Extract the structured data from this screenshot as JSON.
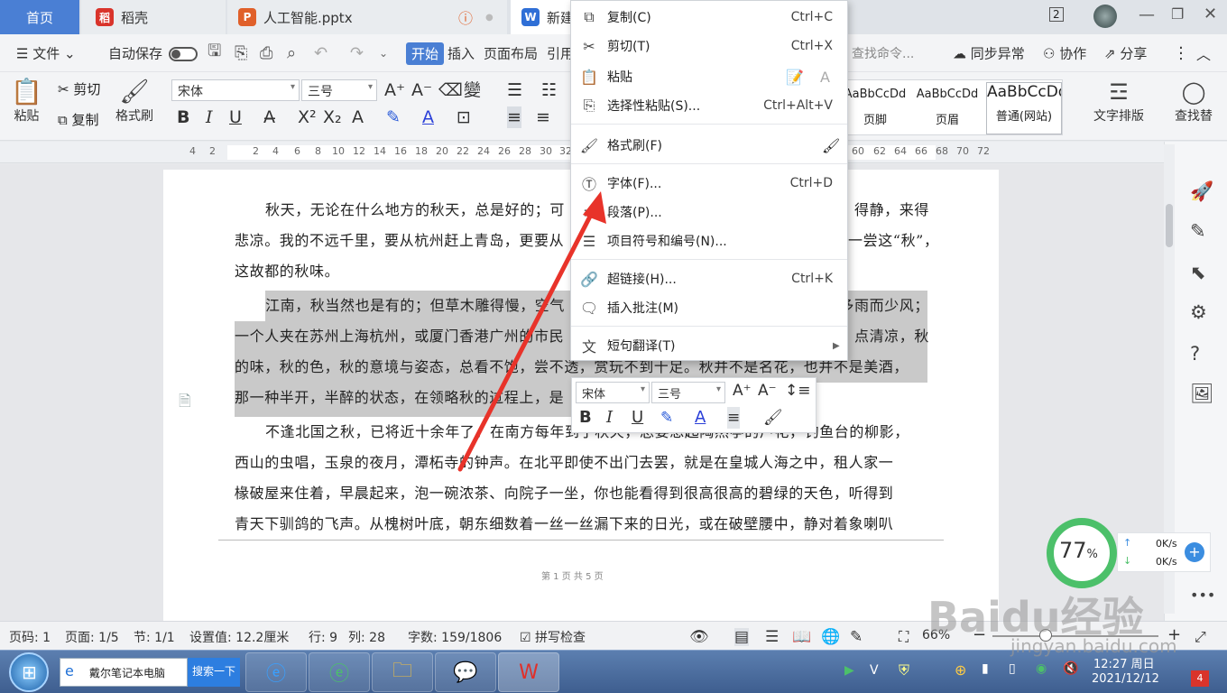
{
  "tabs": {
    "home": "首页",
    "docer": "稻壳",
    "ppt": "人工智能.pptx",
    "doc": "新建"
  },
  "window": {
    "badge": "2"
  },
  "menubar": {
    "file": "文件",
    "autosave": "自动保存",
    "start": "开始",
    "insert": "插入",
    "layout": "页面布局",
    "reference": "引用",
    "search": "查找命令...",
    "sync": "同步异常",
    "collab": "协作",
    "share": "分享"
  },
  "ribbon": {
    "cut": "剪切",
    "copy": "复制",
    "paste": "粘贴",
    "format_painter": "格式刷",
    "font": "宋体",
    "size": "三号",
    "bold": "B",
    "italic": "I",
    "underline": "U",
    "styles": [
      {
        "preview": "AaBbCcDd",
        "name": "页脚"
      },
      {
        "preview": "AaBbCcDd",
        "name": "页眉"
      },
      {
        "preview": "AaBbCcDd",
        "name": "普通(网站)"
      }
    ],
    "text_layout": "文字排版",
    "find_replace": "查找替"
  },
  "ruler": [
    "4",
    "2",
    "2",
    "4",
    "6",
    "8",
    "10",
    "12",
    "14",
    "16",
    "18",
    "20",
    "22",
    "24",
    "26",
    "28",
    "30",
    "32",
    "60",
    "62",
    "64",
    "66",
    "68",
    "70",
    "72"
  ],
  "document": {
    "paragraphs": [
      {
        "lines": [
          "秋天，无论在什么地方的秋天，总是好的；可",
          "得静，来得",
          "悲凉。我的不远千里，要从杭州赶上青岛，更要从",
          "一尝这“秋”，",
          "这故都的秋味。"
        ]
      },
      {
        "lines": [
          "江南，秋当然也是有的；但草木雕得慢，空气",
          "多雨而少风；",
          "一个人夹在苏州上海杭州，或厦门香港广州的市民",
          "点清凉，秋",
          "的味，秋的色，秋的意境与姿态，总看不饱，尝不透，赏玩不到十足。秋并不是名花，也并不是美酒，",
          "那一种半开，半醉的状态，在领略秋的过程上，是"
        ]
      },
      {
        "lines": [
          "不逢北国之秋，已将近十余年了。在南方每年到了秋天，总要想起陶然亭的芦花，钓鱼台的柳影，",
          "西山的虫唱，玉泉的夜月，潭柘寺的钟声。在北平即使不出门去罢，就是在皇城人海之中，租人家一",
          "椽破屋来住着，早晨起来，泡一碗浓茶、向院子一坐，你也能看得到很高很高的碧绿的天色，听得到",
          "青天下驯鸽的飞声。从槐树叶底，朝东细数着一丝一丝漏下来的日光，或在破壁腰中，静对着象喇叭"
        ]
      }
    ],
    "footer": "第 1 页 共 5 页"
  },
  "context_menu": [
    {
      "label": "复制(C)",
      "shortcut": "Ctrl+C",
      "icon": "copy-icon"
    },
    {
      "label": "剪切(T)",
      "shortcut": "Ctrl+X",
      "icon": "scissors-icon"
    },
    {
      "label": "粘贴",
      "shortcut": "",
      "icon": "paste-icon"
    },
    {
      "label": "选择性粘贴(S)...",
      "shortcut": "Ctrl+Alt+V",
      "icon": "paste-special-icon"
    },
    {
      "label": "格式刷(F)",
      "shortcut": "",
      "icon": "format-painter-icon"
    },
    {
      "label": "字体(F)...",
      "shortcut": "Ctrl+D",
      "icon": "font-icon"
    },
    {
      "label": "段落(P)...",
      "shortcut": "",
      "icon": "paragraph-icon"
    },
    {
      "label": "项目符号和编号(N)...",
      "shortcut": "",
      "icon": "bullets-icon"
    },
    {
      "label": "超链接(H)...",
      "shortcut": "Ctrl+K",
      "icon": "link-icon"
    },
    {
      "label": "插入批注(M)",
      "shortcut": "",
      "icon": "comment-icon"
    },
    {
      "label": "短句翻译(T)",
      "shortcut": "",
      "icon": "translate-icon"
    }
  ],
  "mini_toolbar": {
    "font": "宋体",
    "size": "三号"
  },
  "status": {
    "page": "页码: 1",
    "pages": "页面: 1/5",
    "section": "节: 1/1",
    "setting": "设置值: 12.2厘米",
    "row": "行: 9",
    "col": "列: 28",
    "words": "字数: 159/1806",
    "spell": "拼写检查",
    "zoom": "66%"
  },
  "speed": {
    "percent": "77",
    "up": "0K/s",
    "down": "0K/s"
  },
  "taskbar": {
    "search_text": "戴尔笔记本电脑",
    "search_button": "搜索一下",
    "time": "12:27 周日",
    "date": "2021/12/12",
    "notif": "4"
  },
  "watermark": {
    "brand": "Baidu经验",
    "url": "jingyan.baidu.com"
  },
  "colors": {
    "accent": "#4a7fd4",
    "highlight": "#c9c9c9",
    "arrow": "#e8332a",
    "speed_ring": "#4cc06a"
  }
}
